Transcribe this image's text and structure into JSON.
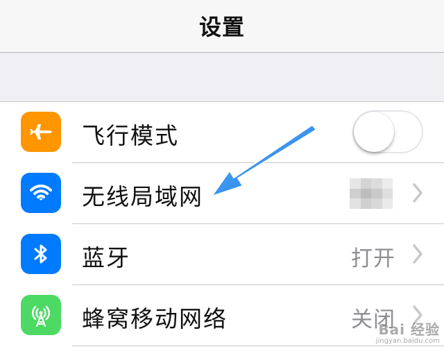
{
  "navbar": {
    "title": "设置"
  },
  "settings": {
    "items": [
      {
        "id": "airplane",
        "label": "飞行模式",
        "icon": "airplane-icon",
        "icon_color": "#ff9500",
        "control": "toggle",
        "toggle_on": false
      },
      {
        "id": "wifi",
        "label": "无线局域网",
        "icon": "wifi-icon",
        "icon_color": "#007aff",
        "control": "disclosure",
        "value_obscured": true
      },
      {
        "id": "bluetooth",
        "label": "蓝牙",
        "icon": "bluetooth-icon",
        "icon_color": "#007aff",
        "control": "disclosure",
        "value": "打开"
      },
      {
        "id": "cellular",
        "label": "蜂窝移动网络",
        "icon": "cellular-antenna-icon",
        "icon_color": "#4cd964",
        "control": "disclosure",
        "value": "关闭"
      }
    ]
  },
  "annotation": {
    "arrow_color": "#2f8ff0",
    "points_to": "wifi"
  },
  "watermark": {
    "main": "Bai 经验",
    "sub": "jingyan.baidu.com"
  }
}
